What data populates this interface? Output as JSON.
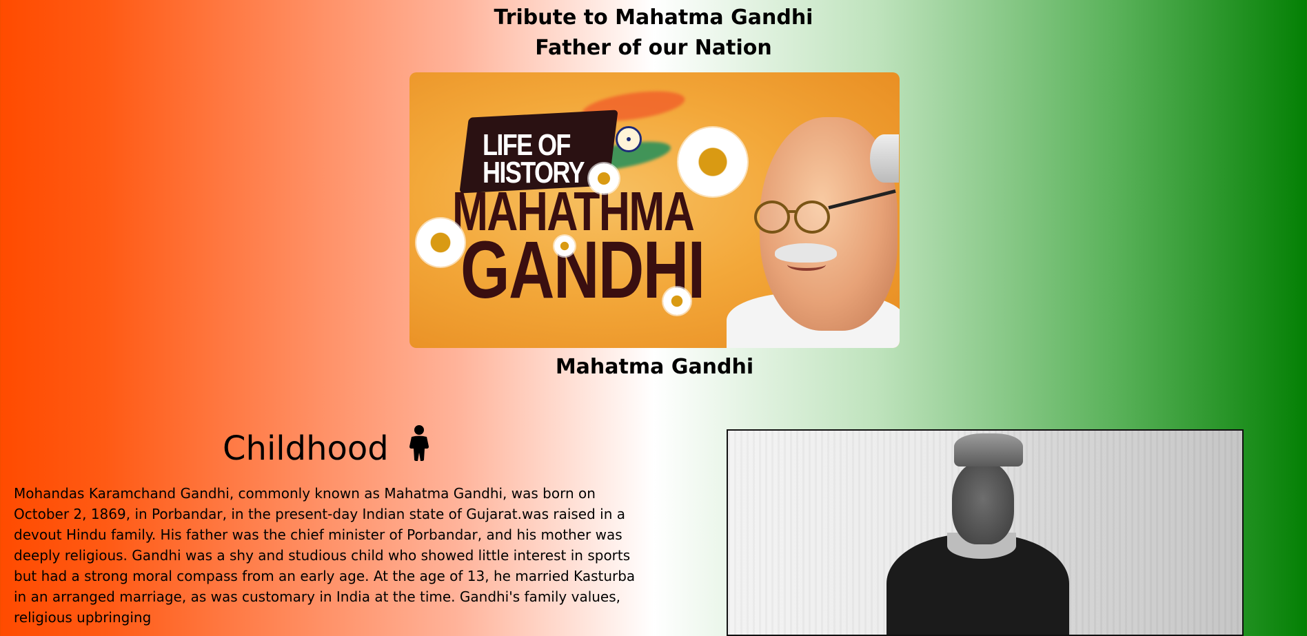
{
  "header": {
    "title_line1": "Tribute to Mahatma Gandhi",
    "title_line2": "Father of our Nation"
  },
  "hero": {
    "badge_text": "LIFE OF HISTORY",
    "title_line1": "MAHATHMA",
    "title_line2": "GANDHI",
    "caption": "Mahatma Gandhi"
  },
  "childhood": {
    "heading": "Childhood",
    "icon": "child-icon",
    "text": "Mohandas Karamchand Gandhi, commonly known as Mahatma Gandhi, was born on October 2, 1869, in Porbandar, in the present-day Indian state of Gujarat.was raised in a devout Hindu family. His father was the chief minister of Porbandar, and his mother was deeply religious. Gandhi was a shy and studious child who showed little interest in sports but had a strong moral compass from an early age. At the age of 13, he married Kasturba in an arranged marriage, as was customary in India at the time. Gandhi's family values, religious upbringing"
  },
  "colors": {
    "saffron": "#ff4b00",
    "white": "#ffffff",
    "green": "#048004"
  }
}
